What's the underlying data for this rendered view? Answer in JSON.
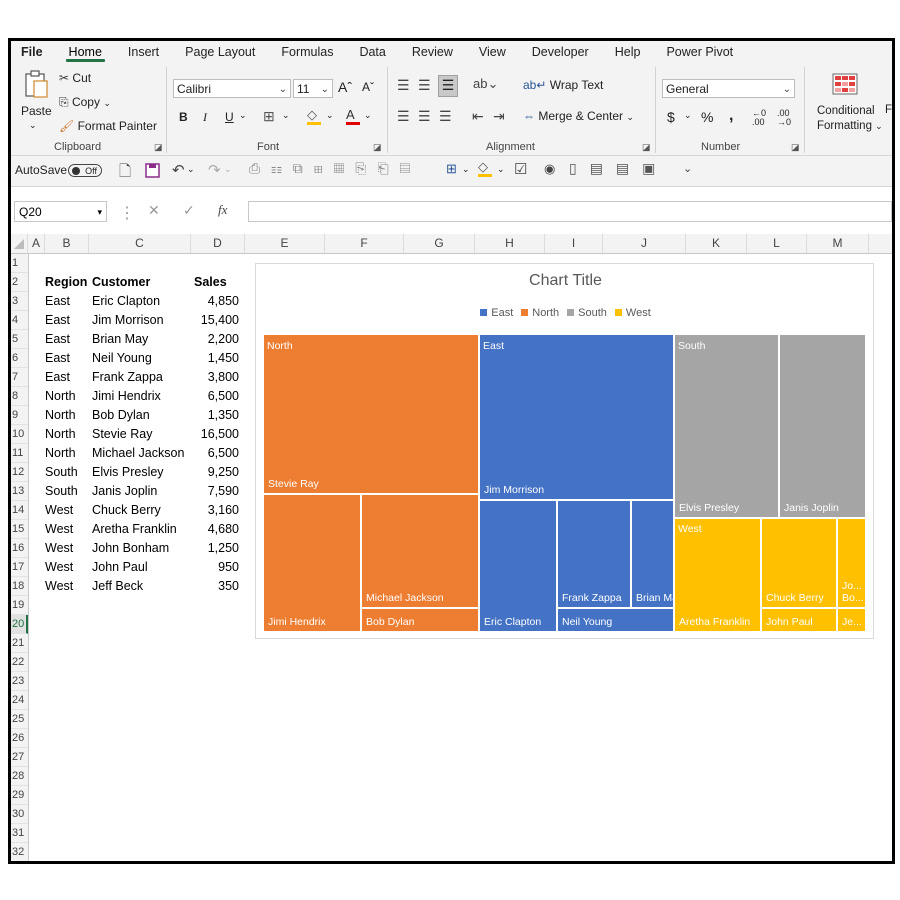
{
  "menu": [
    "File",
    "Home",
    "Insert",
    "Page Layout",
    "Formulas",
    "Data",
    "Review",
    "View",
    "Developer",
    "Help",
    "Power Pivot"
  ],
  "ribbon": {
    "paste": "Paste",
    "cut": "Cut",
    "copy": "Copy",
    "format_painter": "Format Painter",
    "clipboard": "Clipboard",
    "font_name": "Calibri",
    "font_size": "11",
    "font": "Font",
    "bold": "B",
    "italic": "I",
    "underline": "U",
    "wrap_text": "Wrap Text",
    "merge_center": "Merge & Center",
    "alignment": "Alignment",
    "number_format": "General",
    "number": "Number",
    "currency": "$",
    "percent": "%",
    "comma": ",",
    "conditional": "Conditional",
    "formatting": "Formatting",
    "f_cut": "F"
  },
  "qat": {
    "autosave": "AutoSave",
    "toggle": "Off"
  },
  "formula_bar": {
    "name_box": "Q20",
    "fx": "fx",
    "value": ""
  },
  "columns": [
    "A",
    "B",
    "C",
    "D",
    "E",
    "F",
    "G",
    "H",
    "I",
    "J",
    "K",
    "L",
    "M"
  ],
  "rows": [
    "1",
    "2",
    "3",
    "4",
    "5",
    "6",
    "7",
    "8",
    "9",
    "10",
    "11",
    "12",
    "13",
    "14",
    "15",
    "16",
    "17",
    "18",
    "19",
    "20",
    "21",
    "22",
    "23",
    "24",
    "25",
    "26",
    "27",
    "28",
    "29",
    "30",
    "31",
    "32"
  ],
  "selected_row": "20",
  "table": {
    "headers": [
      "Region",
      "Customer",
      "Sales"
    ],
    "rows": [
      [
        "East",
        "Eric Clapton",
        "4,850"
      ],
      [
        "East",
        "Jim Morrison",
        "15,400"
      ],
      [
        "East",
        "Brian May",
        "2,200"
      ],
      [
        "East",
        "Neil Young",
        "1,450"
      ],
      [
        "East",
        "Frank Zappa",
        "3,800"
      ],
      [
        "North",
        "Jimi Hendrix",
        "6,500"
      ],
      [
        "North",
        "Bob Dylan",
        "1,350"
      ],
      [
        "North",
        "Stevie Ray",
        "16,500"
      ],
      [
        "North",
        "Michael Jackson",
        "6,500"
      ],
      [
        "South",
        "Elvis Presley",
        "9,250"
      ],
      [
        "South",
        "Janis Joplin",
        "7,590"
      ],
      [
        "West",
        "Chuck Berry",
        "3,160"
      ],
      [
        "West",
        "Aretha Franklin",
        "4,680"
      ],
      [
        "West",
        "John Bonham",
        "1,250"
      ],
      [
        "West",
        "John Paul",
        "950"
      ],
      [
        "West",
        "Jeff Beck",
        "350"
      ]
    ]
  },
  "colors": {
    "East": "#4472c4",
    "North": "#ed7d31",
    "South": "#a5a5a5",
    "West": "#ffc000",
    "accent": "#217346"
  },
  "icons": [
    "clipboard-icon",
    "scissors-icon",
    "copy-icon",
    "brush-icon",
    "save-icon",
    "undo-icon",
    "redo-icon"
  ],
  "chart_data": {
    "type": "treemap",
    "title": "Chart Title",
    "legend": [
      "East",
      "North",
      "South",
      "West"
    ],
    "legend_position": "top",
    "groups": [
      {
        "name": "North",
        "items": [
          {
            "label": "Stevie Ray",
            "value": 16500
          },
          {
            "label": "Jimi Hendrix",
            "value": 6500
          },
          {
            "label": "Michael Jackson",
            "value": 6500
          },
          {
            "label": "Bob Dylan",
            "value": 1350
          }
        ]
      },
      {
        "name": "East",
        "items": [
          {
            "label": "Jim Morrison",
            "value": 15400
          },
          {
            "label": "Eric Clapton",
            "value": 4850
          },
          {
            "label": "Frank Zappa",
            "value": 3800
          },
          {
            "label": "Brian May",
            "value": 2200
          },
          {
            "label": "Neil Young",
            "value": 1450
          }
        ]
      },
      {
        "name": "South",
        "items": [
          {
            "label": "Elvis Presley",
            "value": 9250
          },
          {
            "label": "Janis Joplin",
            "value": 7590
          }
        ]
      },
      {
        "name": "West",
        "items": [
          {
            "label": "Aretha Franklin",
            "value": 4680
          },
          {
            "label": "Chuck Berry",
            "value": 3160
          },
          {
            "label": "John Paul",
            "value": 950
          },
          {
            "label": "Jo...\nBo...",
            "value": 1250
          },
          {
            "label": "Je...",
            "value": 350
          }
        ]
      }
    ]
  }
}
